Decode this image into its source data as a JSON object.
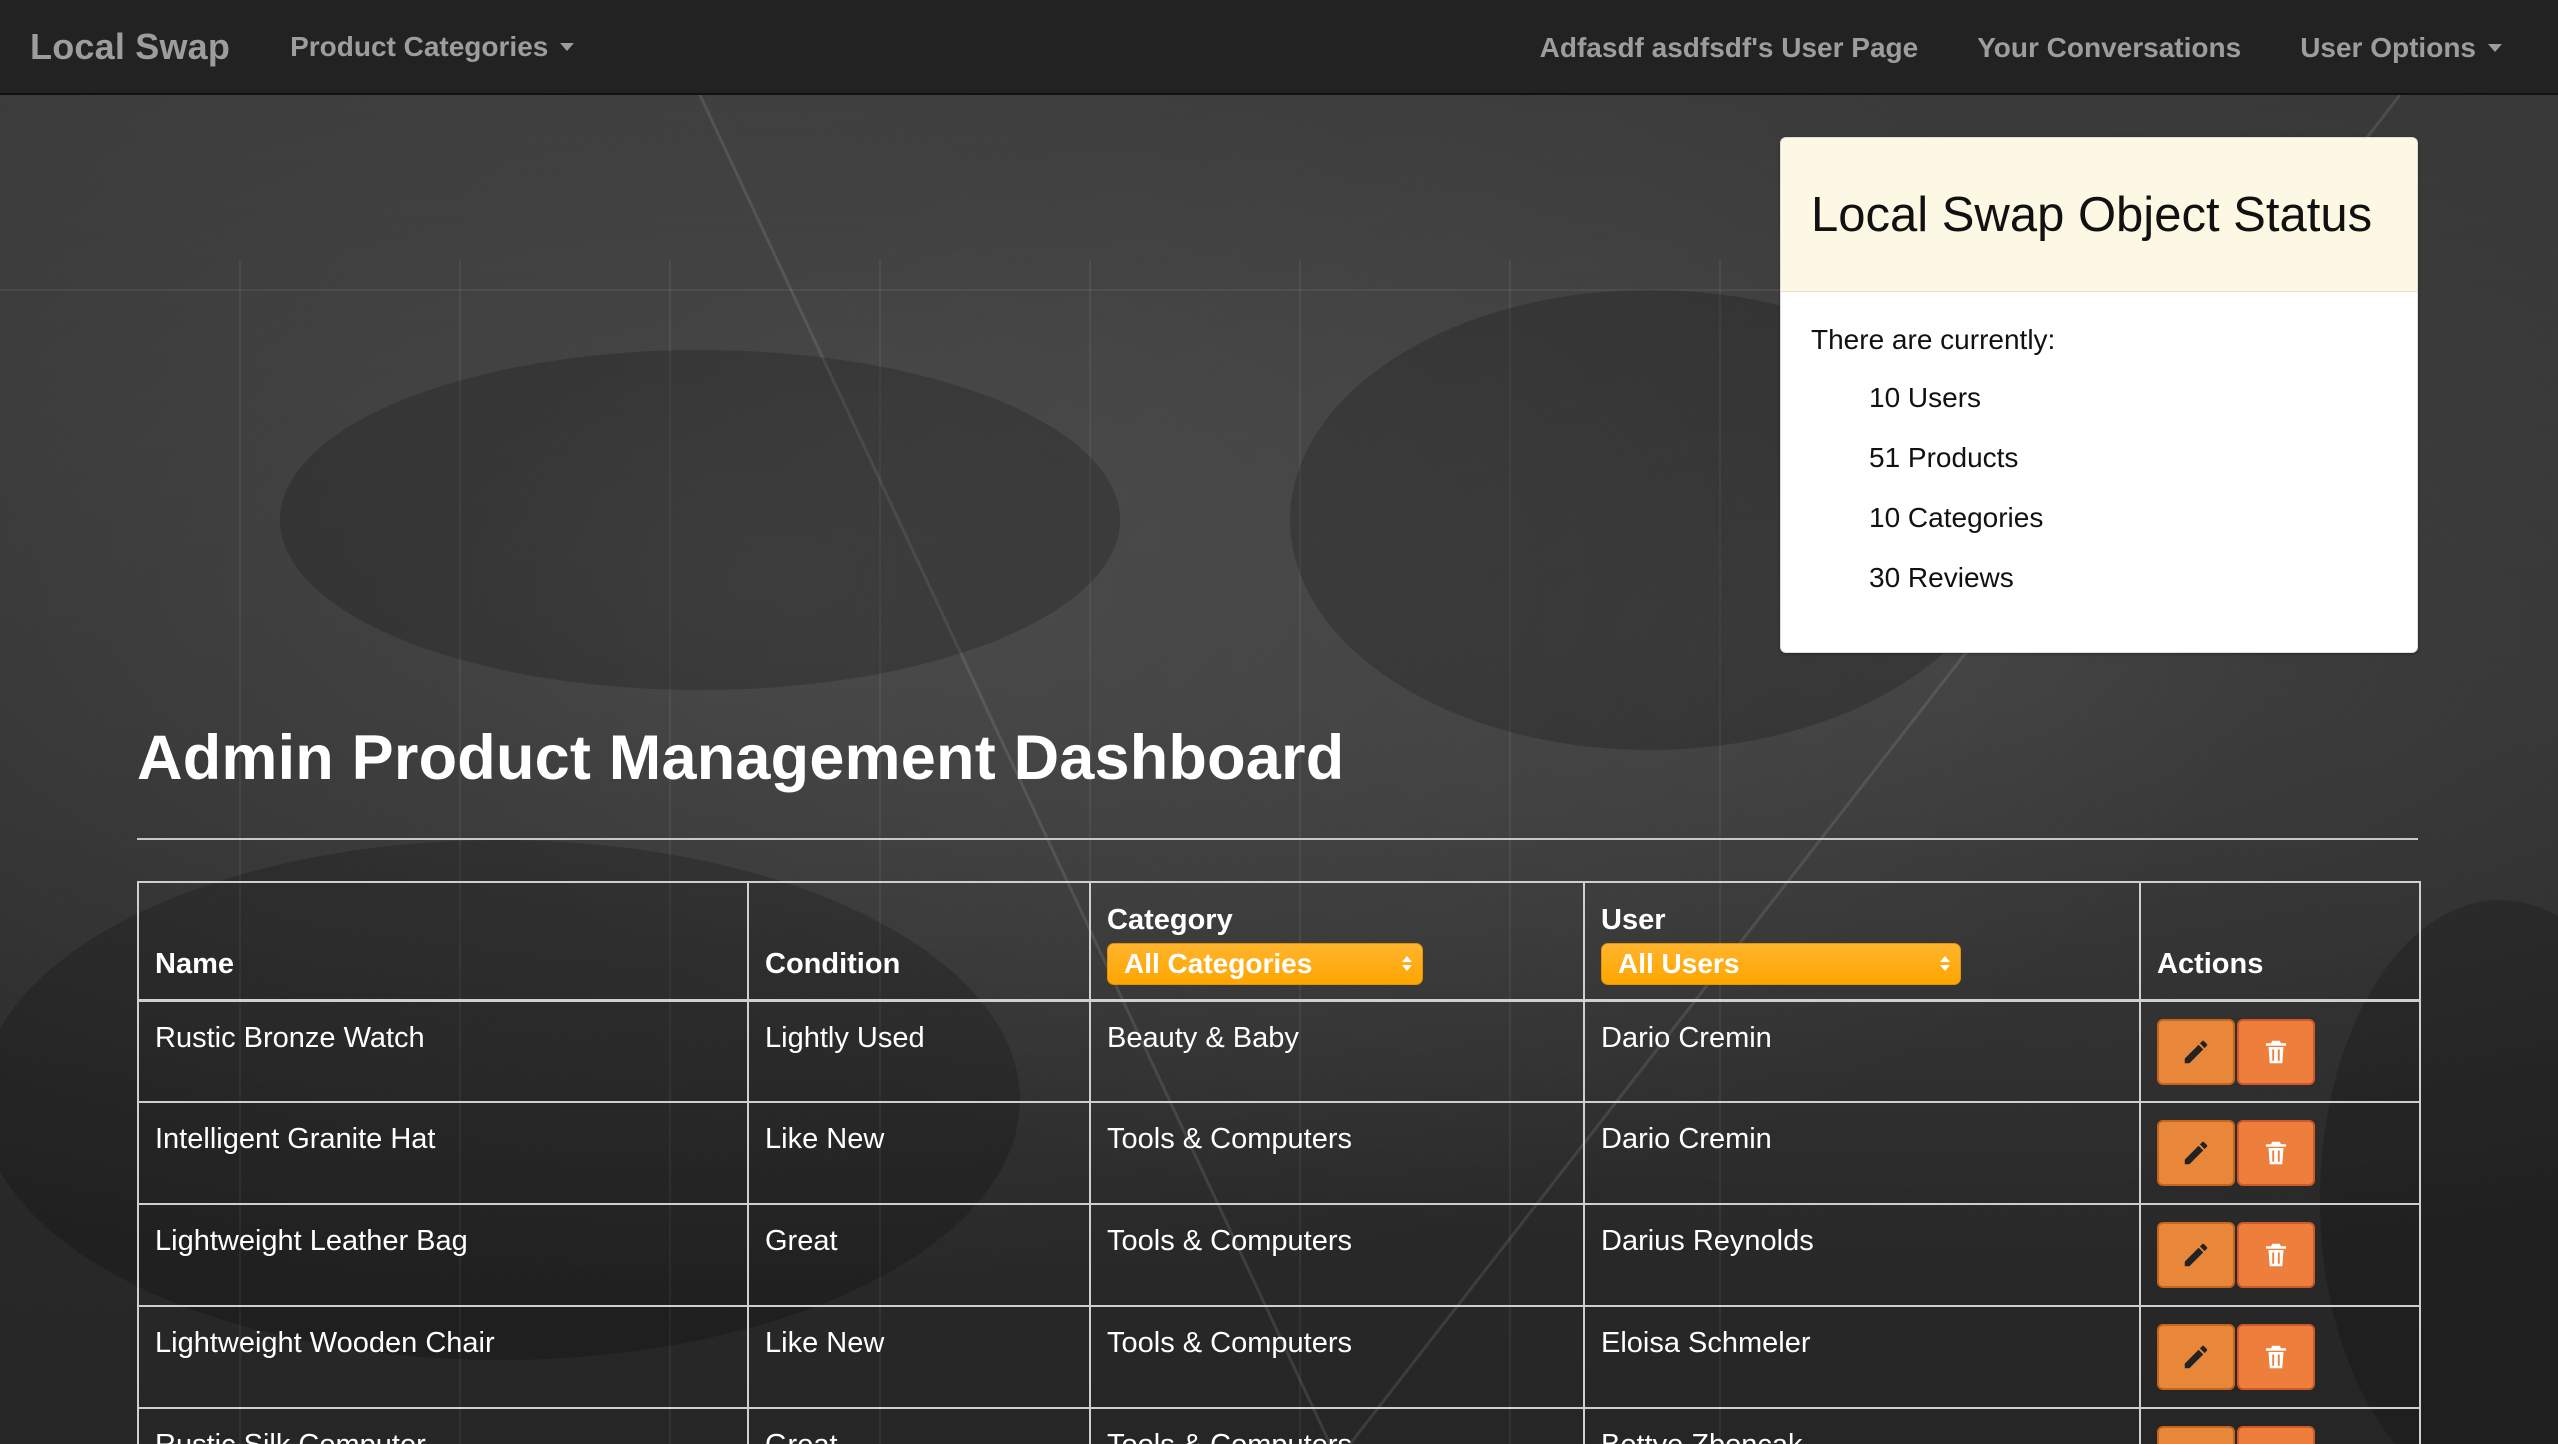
{
  "navbar": {
    "brand": "Local Swap",
    "product_categories": "Product Categories",
    "user_page": "Adfasdf asdfsdf's User Page",
    "conversations": "Your Conversations",
    "user_options": "User Options"
  },
  "status": {
    "title": "Local Swap Object Status",
    "intro": "There are currently:",
    "items": [
      "10 Users",
      "51 Products",
      "10 Categories",
      "30 Reviews"
    ]
  },
  "page_title": "Admin Product Management Dashboard",
  "table": {
    "headers": {
      "name": "Name",
      "condition": "Condition",
      "category": "Category",
      "user": "User",
      "actions": "Actions"
    },
    "filters": {
      "category_selected": "All Categories",
      "user_selected": "All Users"
    },
    "rows": [
      {
        "name": "Rustic Bronze Watch",
        "condition": "Lightly Used",
        "category": "Beauty & Baby",
        "user": "Dario Cremin"
      },
      {
        "name": "Intelligent Granite Hat",
        "condition": "Like New",
        "category": "Tools & Computers",
        "user": "Dario Cremin"
      },
      {
        "name": "Lightweight Leather Bag",
        "condition": "Great",
        "category": "Tools & Computers",
        "user": "Darius Reynolds"
      },
      {
        "name": "Lightweight Wooden Chair",
        "condition": "Like New",
        "category": "Tools & Computers",
        "user": "Eloisa Schmeler"
      },
      {
        "name": "Rustic Silk Computer",
        "condition": "Great",
        "category": "Tools & Computers",
        "user": "Bettye Zboncak"
      }
    ]
  },
  "colors": {
    "navbar_bg": "#222222",
    "nav_text": "#9d9d9d",
    "filter_orange": "#ffa500",
    "action_button": "#e8873a",
    "status_header_bg": "#fcf8e3"
  },
  "icons": {
    "dropdown": "caret-down-icon",
    "edit": "pencil-icon",
    "delete": "trash-icon",
    "select_arrows": "updown-arrows-icon"
  }
}
